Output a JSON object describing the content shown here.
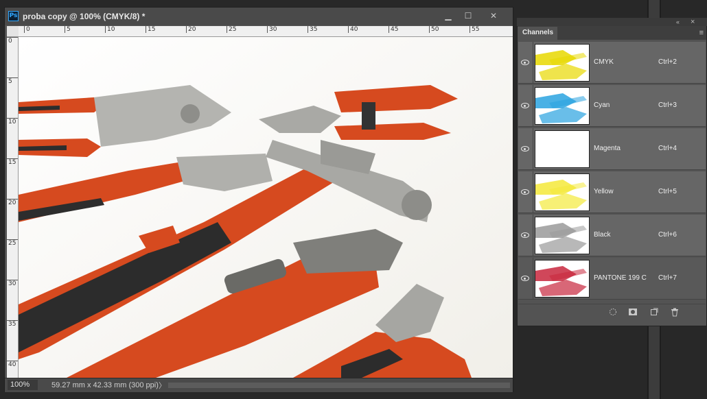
{
  "document": {
    "title": "proba copy @ 100% (CMYK/8) *",
    "app_icon": "Ps",
    "window_buttons": {
      "minimize": "▁",
      "maximize": "☐",
      "close": "✕"
    },
    "ruler_top_ticks": [
      "0",
      "5",
      "10",
      "15",
      "20",
      "25",
      "30",
      "35",
      "40",
      "45",
      "50",
      "55"
    ],
    "ruler_left_ticks": [
      "0",
      "5",
      "10",
      "15",
      "20",
      "25",
      "30",
      "35",
      "40"
    ],
    "status": {
      "zoom": "100%",
      "dimensions": "59.27 mm x 42.33 mm (300 ppi)",
      "arrow": "〉"
    }
  },
  "channels_panel": {
    "tab_label": "Channels",
    "collapse_icon": "«",
    "close_icon": "×",
    "menu_icon": "≡",
    "channels": [
      {
        "name": "CMYK",
        "shortcut": "Ctrl+2",
        "thumb_color": "#e8d800"
      },
      {
        "name": "Cyan",
        "shortcut": "Ctrl+3",
        "thumb_color": "#2aa3e0"
      },
      {
        "name": "Magenta",
        "shortcut": "Ctrl+4",
        "thumb_color": "#ffffff"
      },
      {
        "name": "Yellow",
        "shortcut": "Ctrl+5",
        "thumb_color": "#f4e93a"
      },
      {
        "name": "Black",
        "shortcut": "Ctrl+6",
        "thumb_color": "#9a9a9a"
      },
      {
        "name": "PANTONE 199 C",
        "shortcut": "Ctrl+7",
        "thumb_color": "#c8273d"
      }
    ],
    "footer_icons": [
      "dotted-circle-icon",
      "mask-icon",
      "new-channel-icon",
      "trash-icon"
    ]
  },
  "colors": {
    "tool_orange": "#d94a1e",
    "tool_dark": "#2c2c2c",
    "metal": "#b8b8b8"
  }
}
